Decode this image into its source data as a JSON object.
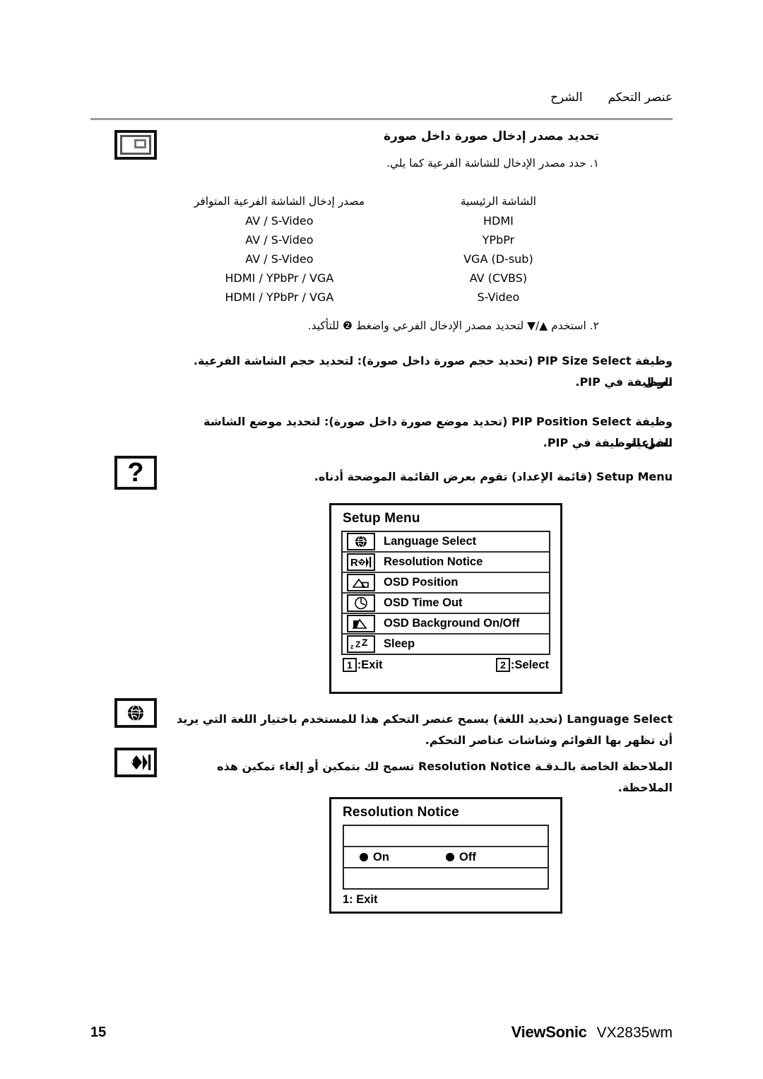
{
  "header": {
    "col_explanation": "الشرح",
    "col_control": "عنصر التحكم"
  },
  "pip_source": {
    "title": "تحديد مصدر إدخال صورة داخل صورة",
    "step1": "١. حدد مصدر الإدخال للشاشة الفرعية كما يلي.",
    "table": {
      "header_main": "الشاشة الرئيسية",
      "header_sub": "مصدر إدخال الشاشة الفرعية المتوافر",
      "rows": [
        {
          "main": "HDMI",
          "sub": "AV / S-Video"
        },
        {
          "main": "YPbPr",
          "sub": "AV / S-Video"
        },
        {
          "main": "VGA (D-sub)",
          "sub": "AV / S-Video"
        },
        {
          "main": "AV (CVBS)",
          "sub": "HDMI / YPbPr / VGA"
        },
        {
          "main": "S-Video",
          "sub": "HDMI / YPbPr / VGA"
        }
      ]
    },
    "step2": "٢. استخدم ▲/▼ لتحديد مصدر الإدخال الفرعي واضغط ❷ للتأكيد."
  },
  "pip_size": {
    "line1": "وظيفة PIP Size Select (تحديد حجم صورة داخل صورة): لتحديد حجم الشاشة الفرعية. تعمل",
    "line2": "الوظيفة في PIP."
  },
  "pip_position": {
    "line1": "وظيفة PIP Position Select (تحديد موضع صورة داخل صورة): لتحديد موضع الشاشة الفرعية.",
    "line2": "تعمل الوظيفة في PIP."
  },
  "setup_menu_intro": {
    "line1": "Setup Menu (قائمة الإعداد) تقوم بعرض القائمة الموضحة أدناه."
  },
  "setup_menu_osd": {
    "title": "Setup Menu",
    "items": [
      {
        "label": "Language Select",
        "icon": "globe-icon"
      },
      {
        "label": "Resolution Notice",
        "icon": "resolution-icon"
      },
      {
        "label": "OSD Position",
        "icon": "osd-position-icon"
      },
      {
        "label": "OSD Time Out",
        "icon": "clock-icon"
      },
      {
        "label": "OSD Background On/Off",
        "icon": "background-icon"
      },
      {
        "label": "Sleep",
        "icon": "sleep-icon"
      }
    ],
    "footer_exit_key": "1",
    "footer_exit_label": ":Exit",
    "footer_select_key": "2",
    "footer_select_label": ":Select"
  },
  "language_select": {
    "line1": "Language Select (تحديد اللغة) يسمح عنصر التحكم هذا للمستخدم باختيار اللغة التي يريد",
    "line2": "أن تظهر بها القوائم وشاشات عناصر التحكم."
  },
  "resolution_notice_text": {
    "line1": "الملاحظة الخاصة بالـدقـة Resolution Notice تسمح لك بتمكين أو إلغاء تمكين هذه الملاحظة."
  },
  "resolution_notice_osd": {
    "title": "Resolution Notice",
    "option_on": "On",
    "option_off": "Off",
    "footer": "1: Exit"
  },
  "margin_icons": {
    "pip": "pip-icon",
    "question": "?",
    "globe": "globe-icon",
    "resolution": "resolution-icon"
  },
  "footer": {
    "page_number": "15",
    "brand": "ViewSonic",
    "model": "VX2835wm"
  }
}
